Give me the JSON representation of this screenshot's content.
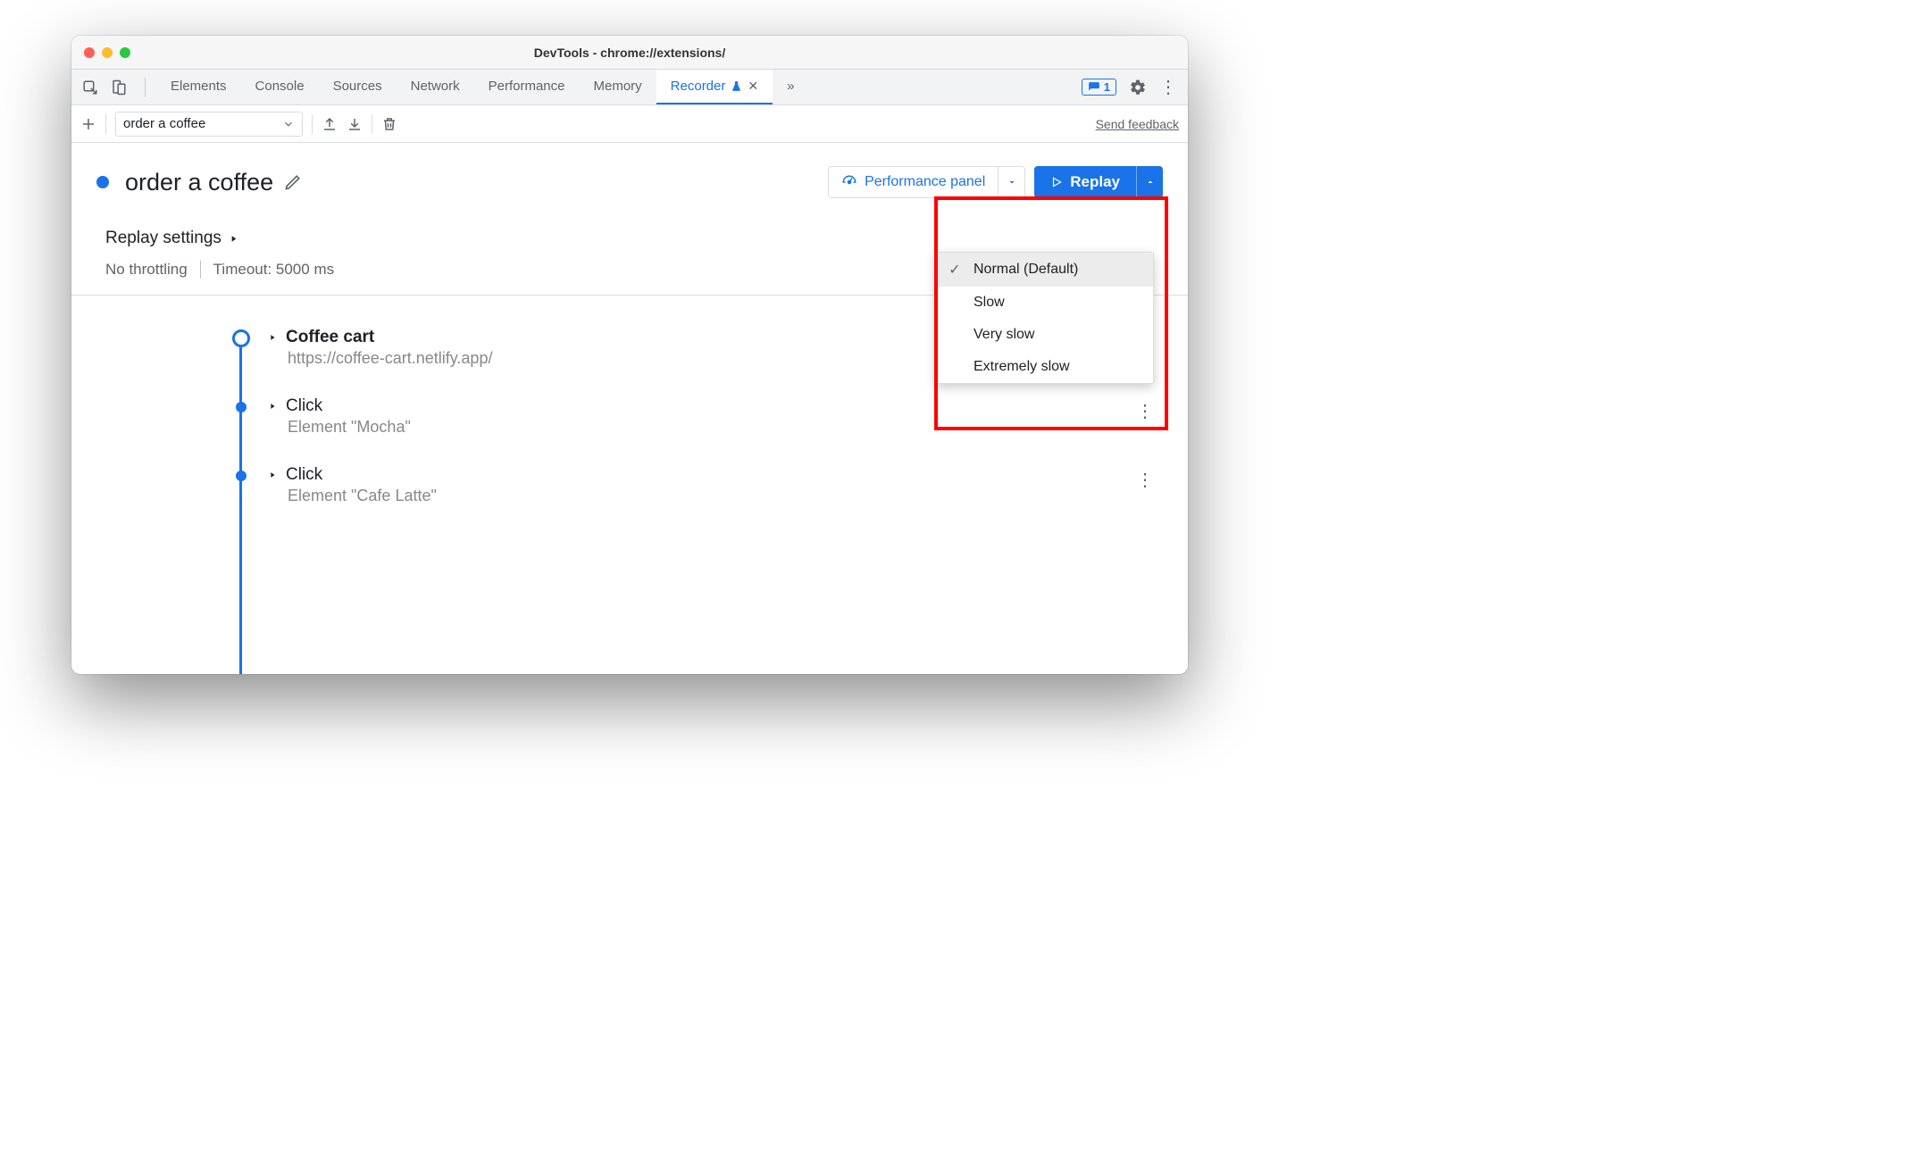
{
  "window_title": "DevTools - chrome://extensions/",
  "tabs": {
    "items": [
      "Elements",
      "Console",
      "Sources",
      "Network",
      "Performance",
      "Memory",
      "Recorder"
    ],
    "active": "Recorder",
    "issue_count": "1"
  },
  "toolbar": {
    "recording_name": "order a coffee",
    "feedback": "Send feedback"
  },
  "header": {
    "title": "order a coffee",
    "perf_panel": "Performance panel",
    "replay": "Replay"
  },
  "settings": {
    "title": "Replay settings",
    "throttling": "No throttling",
    "timeout": "Timeout: 5000 ms"
  },
  "steps": [
    {
      "title": "Coffee cart",
      "sub": "https://coffee-cart.netlify.app/",
      "bold": true,
      "open_node": true
    },
    {
      "title": "Click",
      "sub": "Element \"Mocha\""
    },
    {
      "title": "Click",
      "sub": "Element \"Cafe Latte\""
    }
  ],
  "speed_menu": {
    "items": [
      "Normal (Default)",
      "Slow",
      "Very slow",
      "Extremely slow"
    ],
    "selected": 0
  }
}
